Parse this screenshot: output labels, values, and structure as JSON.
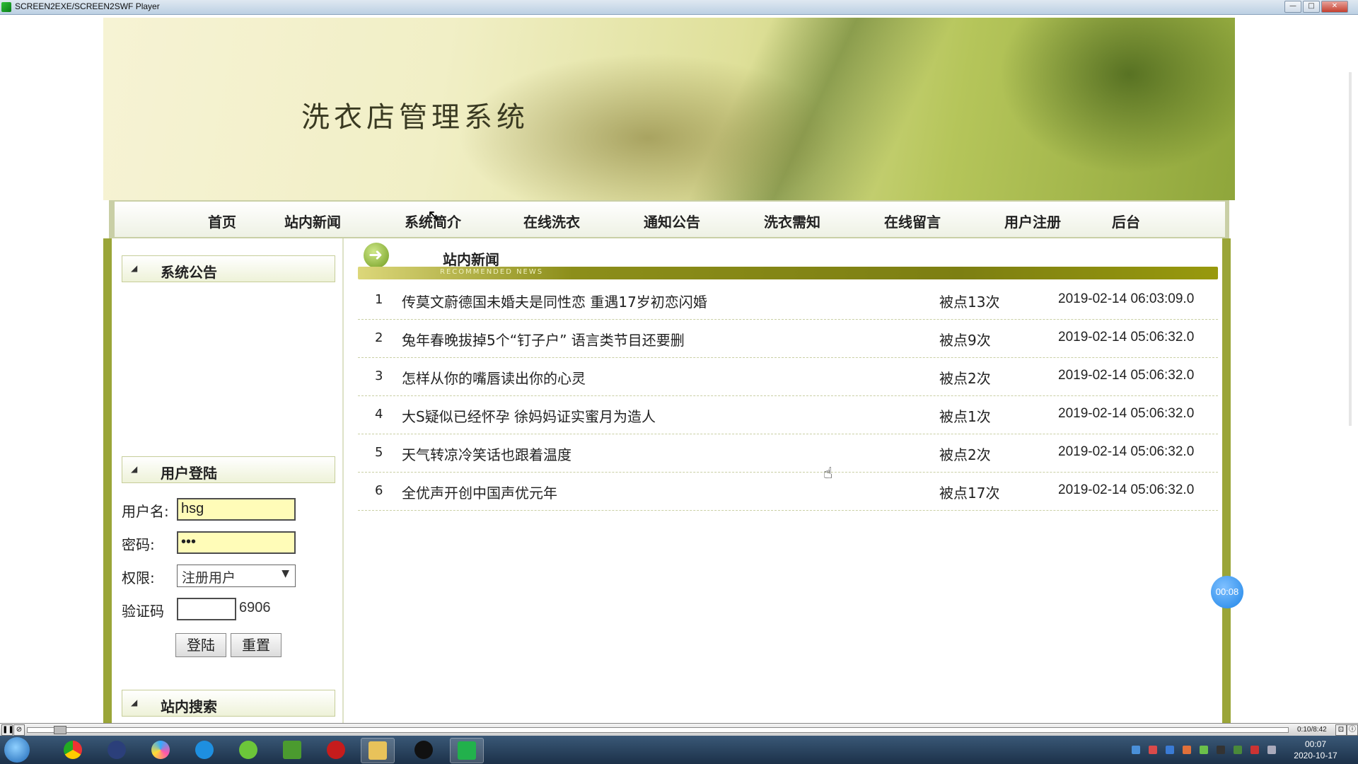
{
  "window": {
    "title": "SCREEN2EXE/SCREEN2SWF Player",
    "minimize": "—",
    "maximize": "□",
    "close": "✕"
  },
  "site": {
    "title": "洗衣店管理系统"
  },
  "nav": {
    "items": [
      "首页",
      "站内新闻",
      "系统简介",
      "在线洗衣",
      "通知公告",
      "洗衣需知",
      "在线留言",
      "用户注册",
      "后台"
    ]
  },
  "sidebar": {
    "announcement_title": "系统公告",
    "login_title": "用户登陆",
    "username_label": "用户名:",
    "username_value": "hsg",
    "password_label": "密码:",
    "password_value": "•••",
    "role_label": "权限:",
    "role_value": "注册用户",
    "captcha_label": "验证码",
    "captcha_code": "6906",
    "login_button": "登陆",
    "reset_button": "重置",
    "search_title": "站内搜索"
  },
  "news": {
    "title": "站内新闻",
    "subtitle": "RECOMMENDED NEWS",
    "rows": [
      {
        "num": "1",
        "headline": "传莫文蔚德国未婚夫是同性恋 重遇17岁初恋闪婚",
        "clicks": "被点13次",
        "time": "2019-02-14 06:03:09.0"
      },
      {
        "num": "2",
        "headline": "兔年春晚拔掉5个“钉子户” 语言类节目还要删",
        "clicks": "被点9次",
        "time": "2019-02-14 05:06:32.0"
      },
      {
        "num": "3",
        "headline": "怎样从你的嘴唇读出你的心灵",
        "clicks": "被点2次",
        "time": "2019-02-14 05:06:32.0"
      },
      {
        "num": "4",
        "headline": "大S疑似已经怀孕 徐妈妈证实蜜月为造人",
        "clicks": "被点1次",
        "time": "2019-02-14 05:06:32.0"
      },
      {
        "num": "5",
        "headline": "天气转凉冷笑话也跟着温度",
        "clicks": "被点2次",
        "time": "2019-02-14 05:06:32.0"
      },
      {
        "num": "6",
        "headline": "全优声开创中国声优元年",
        "clicks": "被点17次",
        "time": "2019-02-14 05:06:32.0"
      }
    ]
  },
  "overlay": {
    "timer": "00:08"
  },
  "player": {
    "time": "0:10/8:42"
  },
  "taskbar": {
    "clock_time": "00:07",
    "clock_date": "2020-10-17",
    "apps": [
      "chrome-icon",
      "menu-app-icon",
      "colorful-app-icon",
      "browser-q-icon",
      "leaf-app-icon",
      "chart-app-icon",
      "flash-app-icon",
      "folder-icon",
      "qq-penguin-icon",
      "screen-recorder-icon"
    ]
  }
}
